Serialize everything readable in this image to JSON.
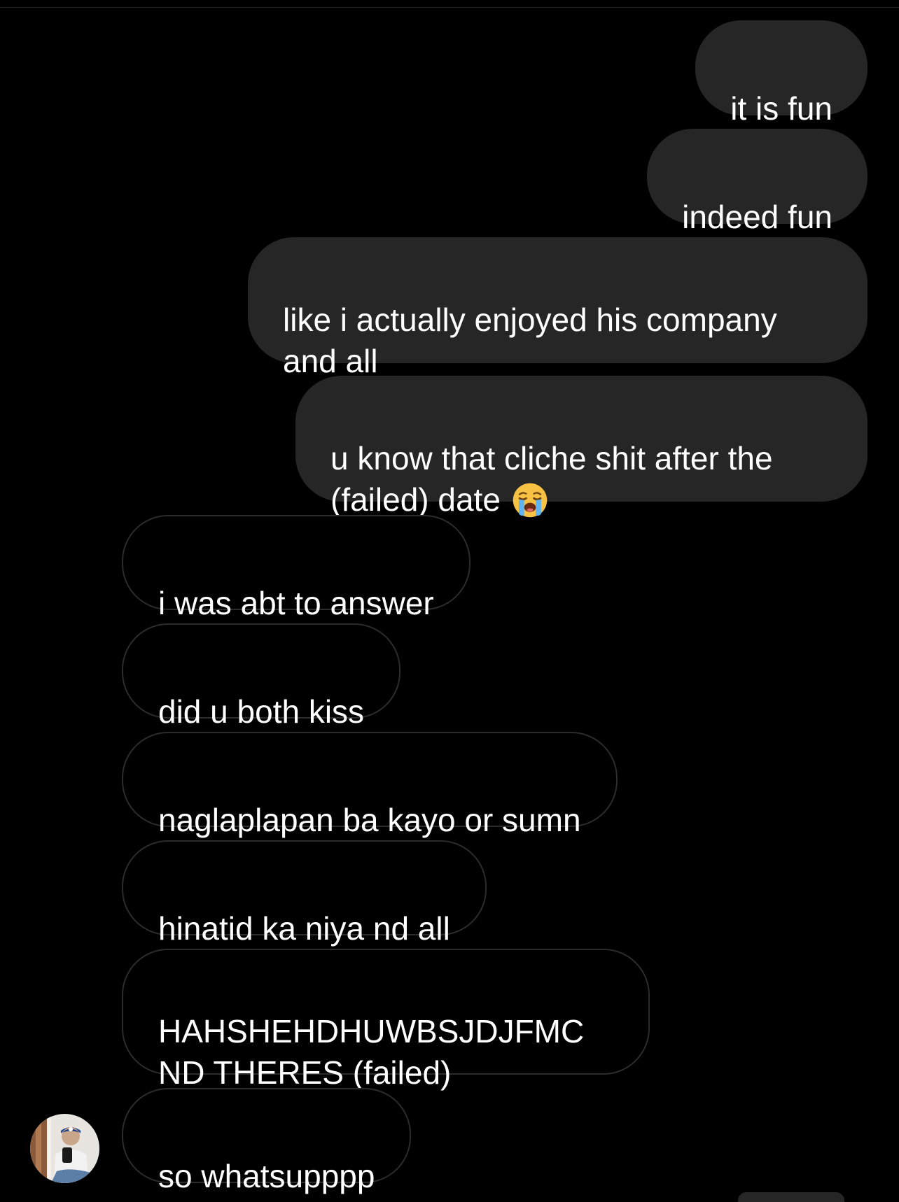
{
  "conversation": {
    "sent": [
      {
        "text": "it is fun"
      },
      {
        "text": "indeed fun"
      },
      {
        "text": "like i actually enjoyed his company\nand all"
      },
      {
        "text": "u know that cliche shit after the\n(failed) date",
        "emoji": "loudly-crying-face"
      }
    ],
    "received": [
      {
        "text": "i was abt to answer"
      },
      {
        "text": "did u both kiss"
      },
      {
        "text": "naglaplapan ba kayo or sumn"
      },
      {
        "text": "hinatid ka niya nd all"
      },
      {
        "text": "HAHSHEHDHUWBSJDJFMC\nND THERES (failed)"
      },
      {
        "text": "so whatsupppp"
      }
    ]
  },
  "colors": {
    "background": "#000000",
    "sent_bubble": "#262626",
    "received_border": "#2c2c2c",
    "text": "#ffffff"
  },
  "contact": {
    "avatar_icon": "profile-photo"
  }
}
